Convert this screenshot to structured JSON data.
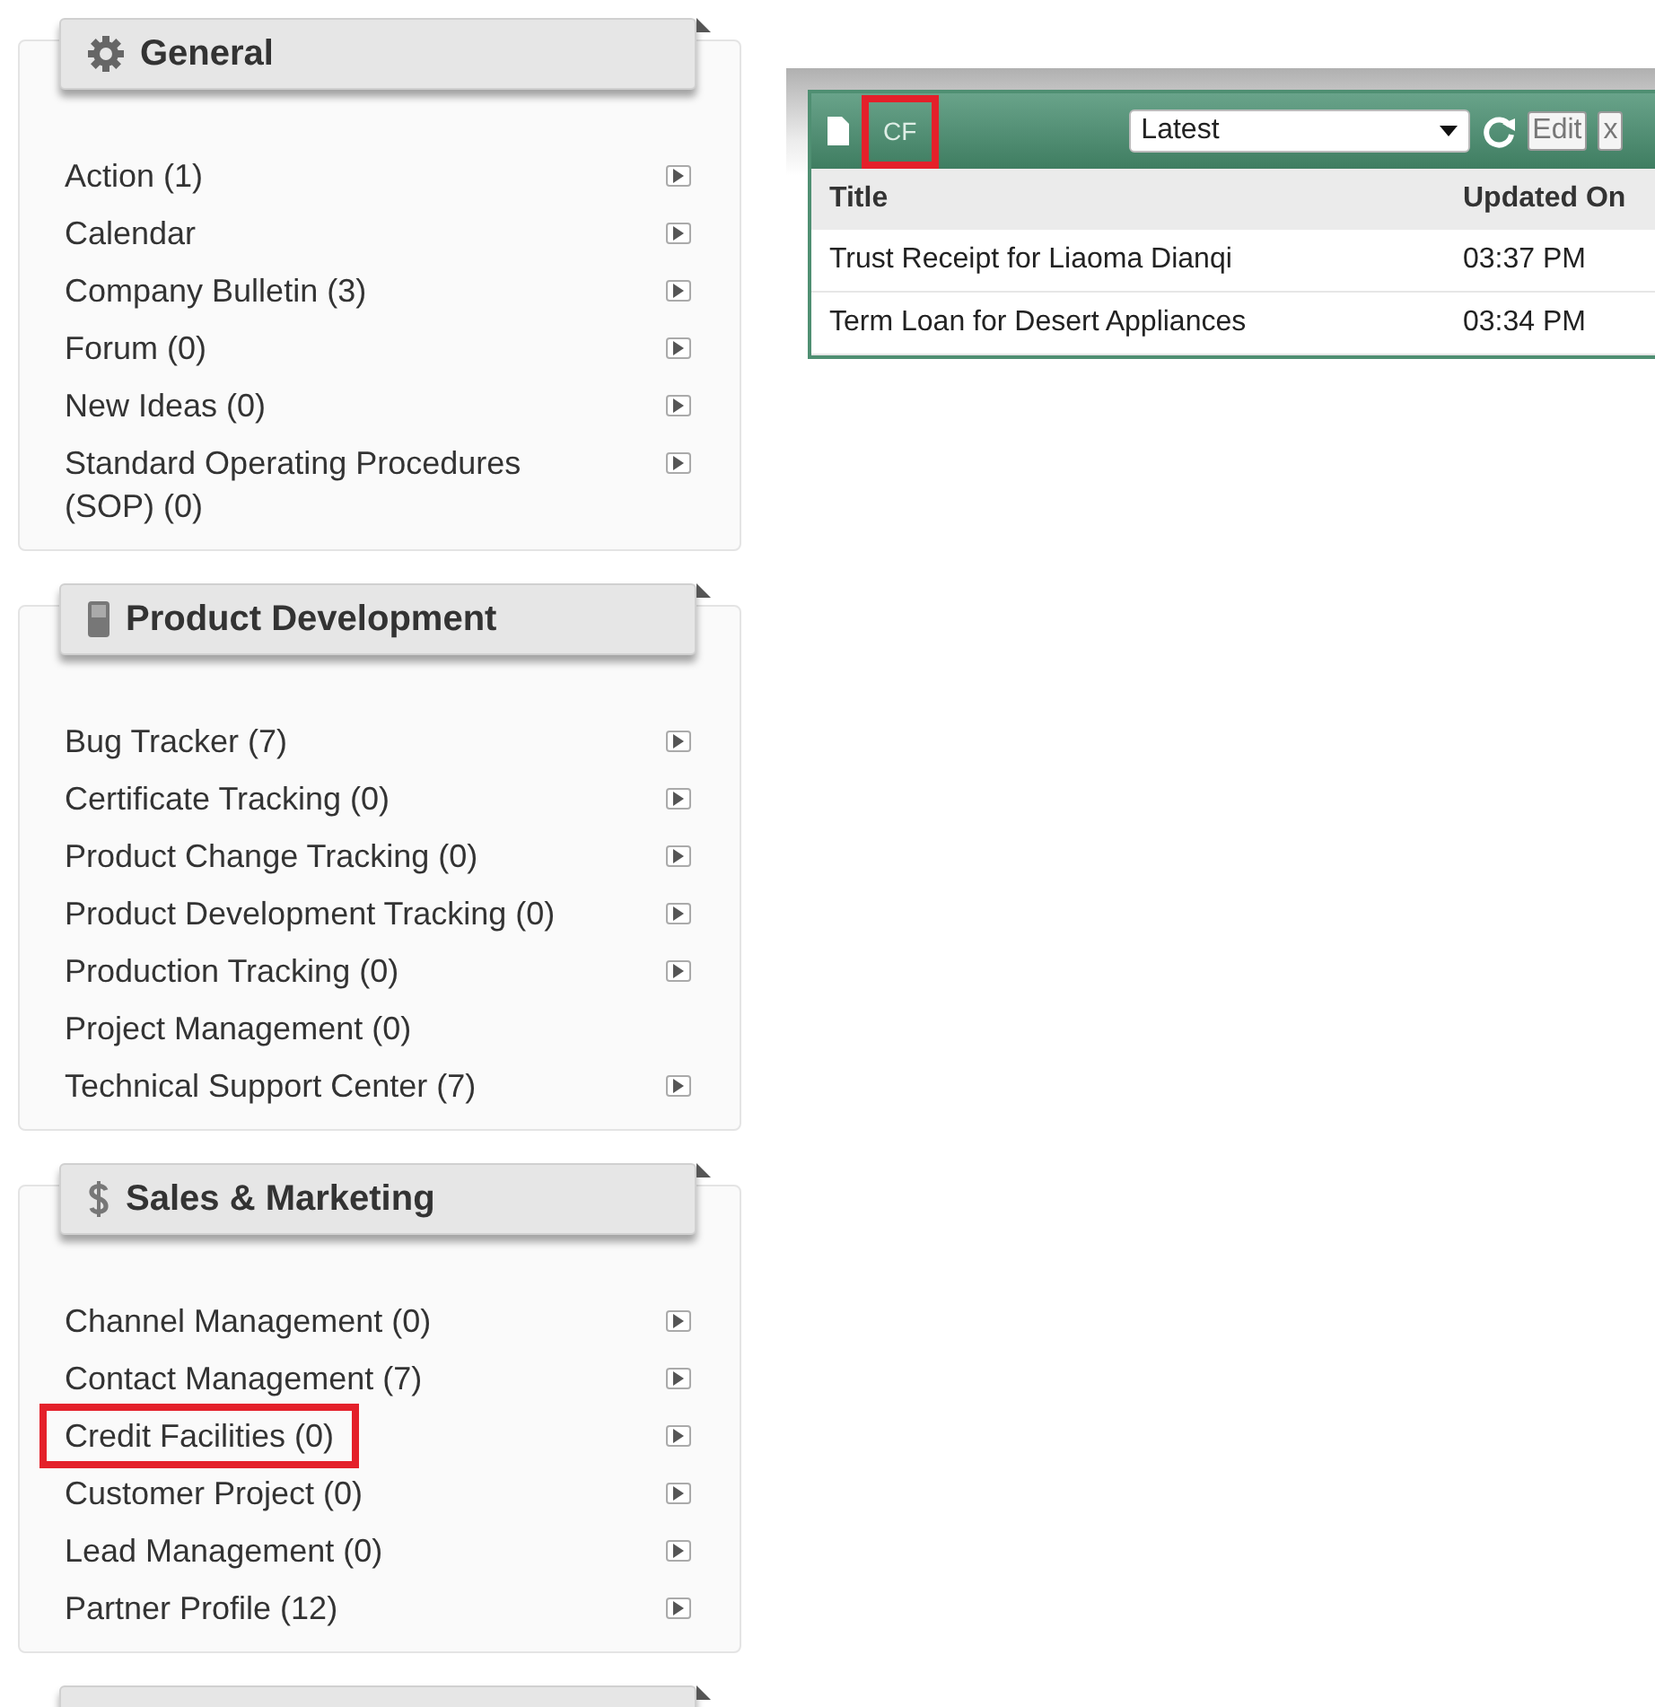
{
  "sections": [
    {
      "title": "General",
      "items": [
        {
          "label": "Action (1)",
          "has_arrow": true,
          "highlighted": false
        },
        {
          "label": "Calendar",
          "has_arrow": true,
          "highlighted": false
        },
        {
          "label": "Company Bulletin (3)",
          "has_arrow": true,
          "highlighted": false
        },
        {
          "label": "Forum (0)",
          "has_arrow": true,
          "highlighted": false
        },
        {
          "label": "New Ideas (0)",
          "has_arrow": true,
          "highlighted": false
        },
        {
          "label": "Standard Operating Procedures (SOP) (0)",
          "has_arrow": true,
          "highlighted": false
        }
      ]
    },
    {
      "title": "Product Development",
      "items": [
        {
          "label": "Bug Tracker (7)",
          "has_arrow": true,
          "highlighted": false
        },
        {
          "label": "Certificate Tracking (0)",
          "has_arrow": true,
          "highlighted": false
        },
        {
          "label": "Product Change Tracking (0)",
          "has_arrow": true,
          "highlighted": false
        },
        {
          "label": "Product Development Tracking (0)",
          "has_arrow": true,
          "highlighted": false
        },
        {
          "label": "Production Tracking (0)",
          "has_arrow": true,
          "highlighted": false
        },
        {
          "label": "Project Management (0)",
          "has_arrow": false,
          "highlighted": false
        },
        {
          "label": "Technical Support Center (7)",
          "has_arrow": true,
          "highlighted": false
        }
      ]
    },
    {
      "title": "Sales & Marketing",
      "items": [
        {
          "label": "Channel Management (0)",
          "has_arrow": true,
          "highlighted": false
        },
        {
          "label": "Contact Management (7)",
          "has_arrow": true,
          "highlighted": false
        },
        {
          "label": "Credit Facilities (0)",
          "has_arrow": true,
          "highlighted": true
        },
        {
          "label": "Customer Project (0)",
          "has_arrow": true,
          "highlighted": false
        },
        {
          "label": "Lead Management (0)",
          "has_arrow": true,
          "highlighted": false
        },
        {
          "label": "Partner Profile (12)",
          "has_arrow": true,
          "highlighted": false
        }
      ]
    }
  ],
  "widget": {
    "title": "CF",
    "title_highlighted": true,
    "filter": "Latest",
    "edit_button": "Edit",
    "close_button": "x",
    "columns": [
      "Title",
      "Updated On"
    ],
    "rows": [
      {
        "title": "Trust Receipt for Liaoma Dianqi",
        "updated_on": "03:37 PM"
      },
      {
        "title": "Term Loan for Desert Appliances",
        "updated_on": "03:34 PM"
      }
    ]
  }
}
